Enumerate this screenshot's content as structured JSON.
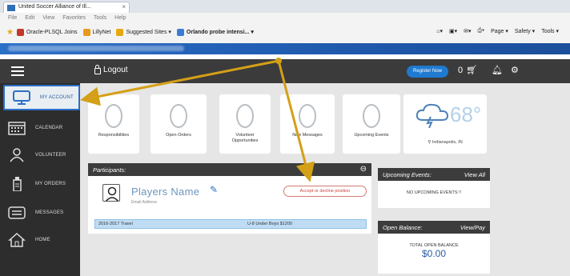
{
  "browser": {
    "tab_title": "United Soccer Alliance of Ill...",
    "tab_close": "×",
    "menu": [
      "File",
      "Edit",
      "View",
      "Favorites",
      "Tools",
      "Help"
    ],
    "favorites": [
      {
        "label": "Oracle-PLSQL Joins",
        "color": "#c0392b"
      },
      {
        "label": "LillyNet",
        "color": "#e89a1c"
      },
      {
        "label": "Suggested Sites ▾",
        "color": "#e5a90f"
      },
      {
        "label": "Orlando probe intensi... ▾",
        "color": "#3a7bd5"
      }
    ],
    "tools": [
      "Page ▾",
      "Safety ▾",
      "Tools ▾"
    ]
  },
  "nav": {
    "logout": "Logout",
    "register": "Register Now",
    "cart_count": "0"
  },
  "sidebar": {
    "items": [
      {
        "label": "MY ACCOUNT",
        "icon": "monitor-icon"
      },
      {
        "label": "CALENDAR",
        "icon": "calendar-icon"
      },
      {
        "label": "VOLUNTEER",
        "icon": "volunteer-icon"
      },
      {
        "label": "MY ORDERS",
        "icon": "orders-icon"
      },
      {
        "label": "MESSAGES",
        "icon": "messages-icon"
      },
      {
        "label": "HOME",
        "icon": "home-icon"
      }
    ]
  },
  "stats": [
    {
      "label": "Responsibilities"
    },
    {
      "label": "Open Orders"
    },
    {
      "label": "Volunteer Opportunities"
    },
    {
      "label": "New Messages"
    },
    {
      "label": "Upcoming Events"
    }
  ],
  "weather": {
    "temp": "68°",
    "location": "Indianapolis, IN"
  },
  "participants": {
    "title": "Participants:",
    "player_name": "Players Name",
    "email_label": "Email Address",
    "accept_label": "Accept or decline position",
    "registration": "2016-2017 Travel",
    "team": "U-8 Under Boys $1200"
  },
  "upcoming": {
    "title": "Upcoming Events:",
    "link": "View All",
    "empty": "NO UPCOMING EVENTS !!"
  },
  "balance": {
    "title": "Open Balance:",
    "link": "View/Pay",
    "label": "TOTAL OPEN BALANCE",
    "amount": "$0.00"
  },
  "colors": {
    "accent": "#2b6fc7",
    "annotation_arrow": "#d4a017",
    "nav_dark": "#3b3b3b",
    "sidebar_dark": "#2d2d2d"
  }
}
